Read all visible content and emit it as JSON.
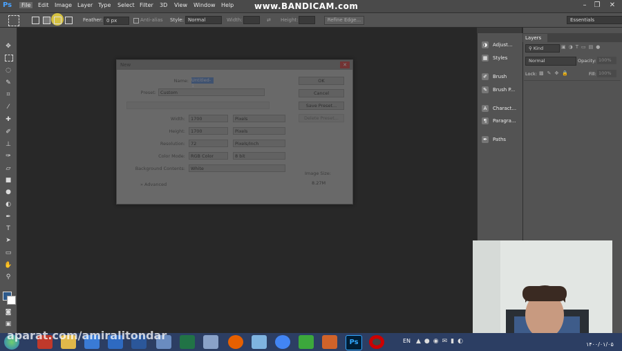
{
  "app": {
    "logo": "Ps",
    "recorder_watermark": "www.BANDICAM.com"
  },
  "menu": [
    "File",
    "Edit",
    "Image",
    "Layer",
    "Type",
    "Select",
    "Filter",
    "3D",
    "View",
    "Window",
    "Help"
  ],
  "options_bar": {
    "feather_label": "Feather:",
    "feather_value": "0 px",
    "antialias_label": "Anti-alias",
    "style_label": "Style:",
    "style_value": "Normal",
    "width_label": "Width:",
    "height_label": "Height:",
    "refine_edge": "Refine Edge...",
    "workspace": "Essentials"
  },
  "dialog": {
    "title": "New",
    "name_label": "Name:",
    "name_value": "Untitled-1",
    "preset_label": "Preset:",
    "preset_value": "Custom",
    "width_label": "Width:",
    "width_value": "1700",
    "width_unit": "Pixels",
    "height_label": "Height:",
    "height_value": "1700",
    "height_unit": "Pixels",
    "resolution_label": "Resolution:",
    "resolution_value": "72",
    "resolution_unit": "Pixels/Inch",
    "color_mode_label": "Color Mode:",
    "color_mode_value": "RGB Color",
    "color_depth_value": "8 bit",
    "background_label": "Background Contents:",
    "background_value": "White",
    "advanced_label": "Advanced",
    "ok_label": "OK",
    "cancel_label": "Cancel",
    "save_preset_label": "Save Preset...",
    "delete_preset_label": "Delete Preset...",
    "image_size_label": "Image Size:",
    "image_size_value": "8.27M"
  },
  "panels": {
    "items": [
      {
        "label": "Adjust...",
        "icon": "adjustments-icon"
      },
      {
        "label": "Styles",
        "icon": "styles-icon"
      },
      {
        "label": "Brush",
        "icon": "brush-icon"
      },
      {
        "label": "Brush P...",
        "icon": "brush-presets-icon"
      },
      {
        "label": "Charact...",
        "icon": "character-icon"
      },
      {
        "label": "Paragra...",
        "icon": "paragraph-icon"
      },
      {
        "label": "Paths",
        "icon": "paths-icon"
      }
    ]
  },
  "layers": {
    "tab_label": "Layers",
    "kind_label": "Kind",
    "blend_mode": "Normal",
    "opacity_label": "Opacity:",
    "opacity_value": "100%",
    "lock_label": "Lock:",
    "fill_label": "Fill:",
    "fill_value": "100%"
  },
  "taskbar": {
    "watermark": "aparat.com/amiralitondar",
    "language": "EN",
    "clock": "۱۴۰۰/۰۱/۰۵"
  },
  "colors": {
    "accent": "#4aa3ff",
    "menubar": "#4a4a4a",
    "panel": "#535353",
    "canvas": "#282828",
    "taskbar": "#2c3e63"
  }
}
